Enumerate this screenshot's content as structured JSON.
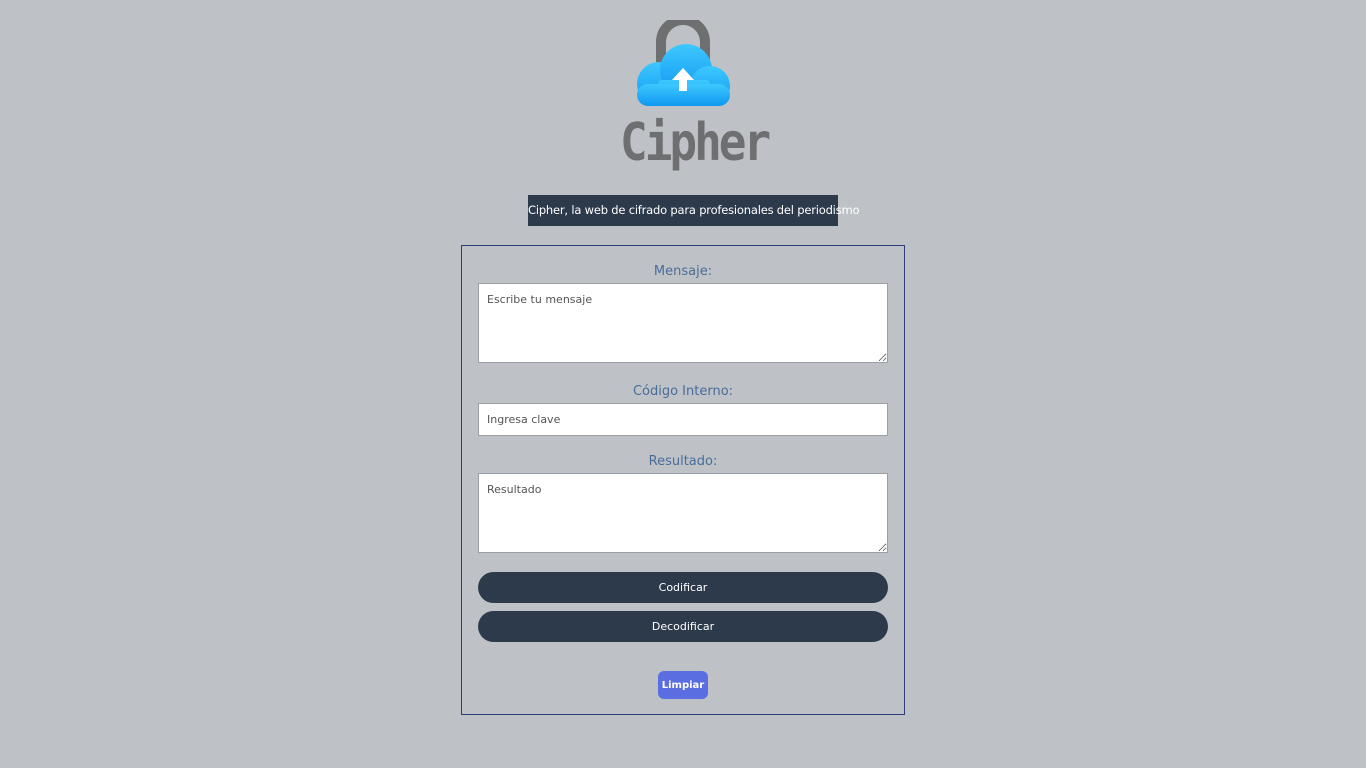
{
  "brand": {
    "name": "Cipher",
    "tagline": "Cipher, la web de cifrado para profesionales del periodismo"
  },
  "form": {
    "message_label": "Mensaje:",
    "message_placeholder": "Escribe tu mensaje",
    "message_value": "",
    "key_label": "Código Interno:",
    "key_placeholder": "Ingresa clave",
    "key_value": "",
    "result_label": "Resultado:",
    "result_placeholder": "Resultado",
    "result_value": ""
  },
  "actions": {
    "encode_label": "Codificar",
    "decode_label": "Decodificar",
    "clear_label": "Limpiar"
  },
  "colors": {
    "background": "#bec2c6",
    "dark_navy": "#2c3a4c",
    "label_blue": "#4a6c9a",
    "clear_button": "#5b6ee1",
    "cloud_blue": "#1ab0fb",
    "lock_gray": "#6e6f71"
  },
  "icons": {
    "logo": "cloud-lock-upload-icon"
  }
}
